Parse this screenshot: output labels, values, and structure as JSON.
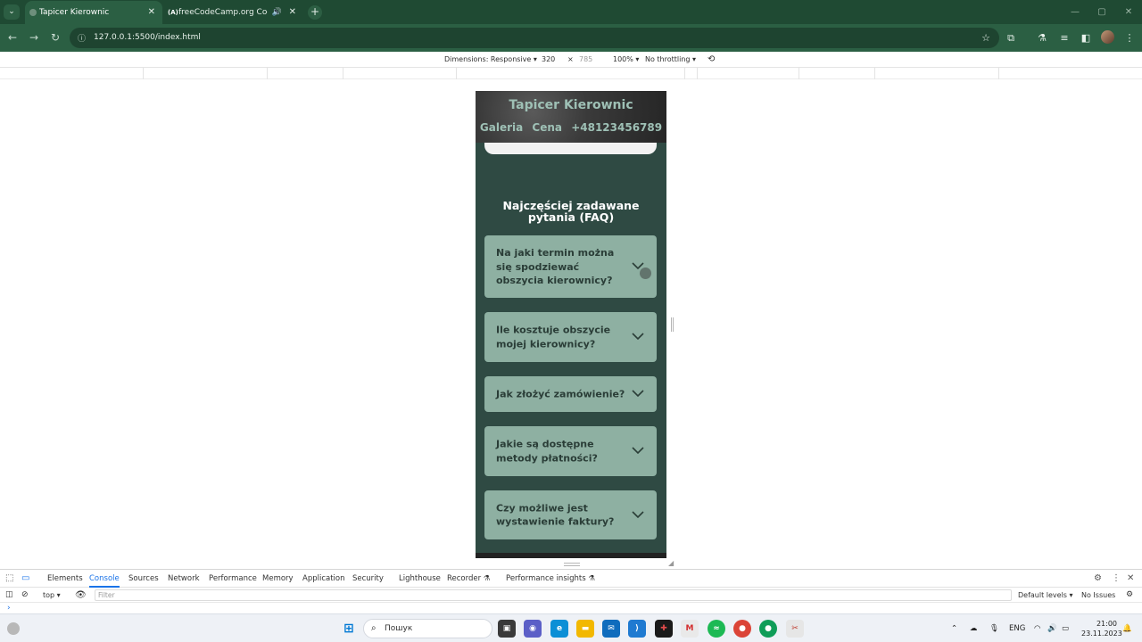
{
  "browser": {
    "tabs": [
      {
        "title": "Tapicer Kierownic",
        "active": true
      },
      {
        "title": "freeCodeCamp.org Code Radio",
        "active": false,
        "favicon_text": "(A)"
      }
    ],
    "url": "127.0.0.1:5500/index.html"
  },
  "device_toolbar": {
    "dimensions_label": "Dimensions: Responsive ▾",
    "width": "320",
    "times": "×",
    "height": "785",
    "zoom": "100% ▾",
    "throttle": "No throttling ▾"
  },
  "site": {
    "title": "Tapicer Kierownic",
    "nav": [
      "Galeria",
      "Cena",
      "+48123456789"
    ],
    "faq_heading": "Najczęściej zadawane pytania (FAQ)",
    "faq": [
      {
        "question": "Na jaki termin można się spodziewać obszycia kierownicy?"
      },
      {
        "question": "Ile kosztuje obszycie mojej kierownicy?"
      },
      {
        "question": "Jak złożyć zamówienie?"
      },
      {
        "question": "Jakie są dostępne metody płatności?"
      },
      {
        "question": "Czy możliwe jest wystawienie faktury?"
      }
    ]
  },
  "devtools": {
    "tabs": [
      "Elements",
      "Console",
      "Sources",
      "Network",
      "Performance",
      "Memory",
      "Application",
      "Security",
      "Lighthouse",
      "Recorder ⚗",
      "Performance insights ⚗"
    ],
    "active_tab": "Console",
    "context": "top ▾",
    "filter_placeholder": "Filter",
    "levels": "Default levels ▾",
    "issues": "No Issues",
    "prompt": "›"
  },
  "taskbar": {
    "search_placeholder": "Пошук",
    "lang": "ENG",
    "time": "21:00",
    "date": "23.11.2023"
  },
  "colors": {
    "chrome_dark": "#1f4a33",
    "chrome_toolbar": "#2b5f43",
    "site_bg": "#2f4a43",
    "faq_card": "#8eb0a2",
    "accent": "#1a73e8"
  }
}
